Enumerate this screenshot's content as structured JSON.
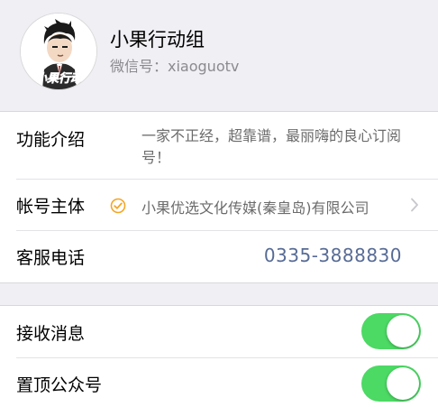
{
  "account": {
    "name": "小果行动组",
    "wechat_id_label": "微信号：",
    "wechat_id": "xiaoguotv",
    "avatar_logo_text": "小果行动组"
  },
  "info": {
    "intro": {
      "label": "功能介绍",
      "text": "一家不正经，超靠谱，最丽嗨的良心订阅号！"
    },
    "owner": {
      "label": "帐号主体",
      "text": "小果优选文化传媒(秦皇岛)有限公司",
      "verified_icon": "verified-check-icon"
    },
    "phone": {
      "label": "客服电话",
      "number": "0335-3888830"
    }
  },
  "settings": {
    "receive_messages": {
      "label": "接收消息",
      "enabled": true
    },
    "pin_to_top": {
      "label": "置顶公众号",
      "enabled": true
    }
  },
  "colors": {
    "toggle_on": "#4cd964",
    "link": "#576b95",
    "verified": "#f5a623",
    "background": "#efeff4"
  }
}
